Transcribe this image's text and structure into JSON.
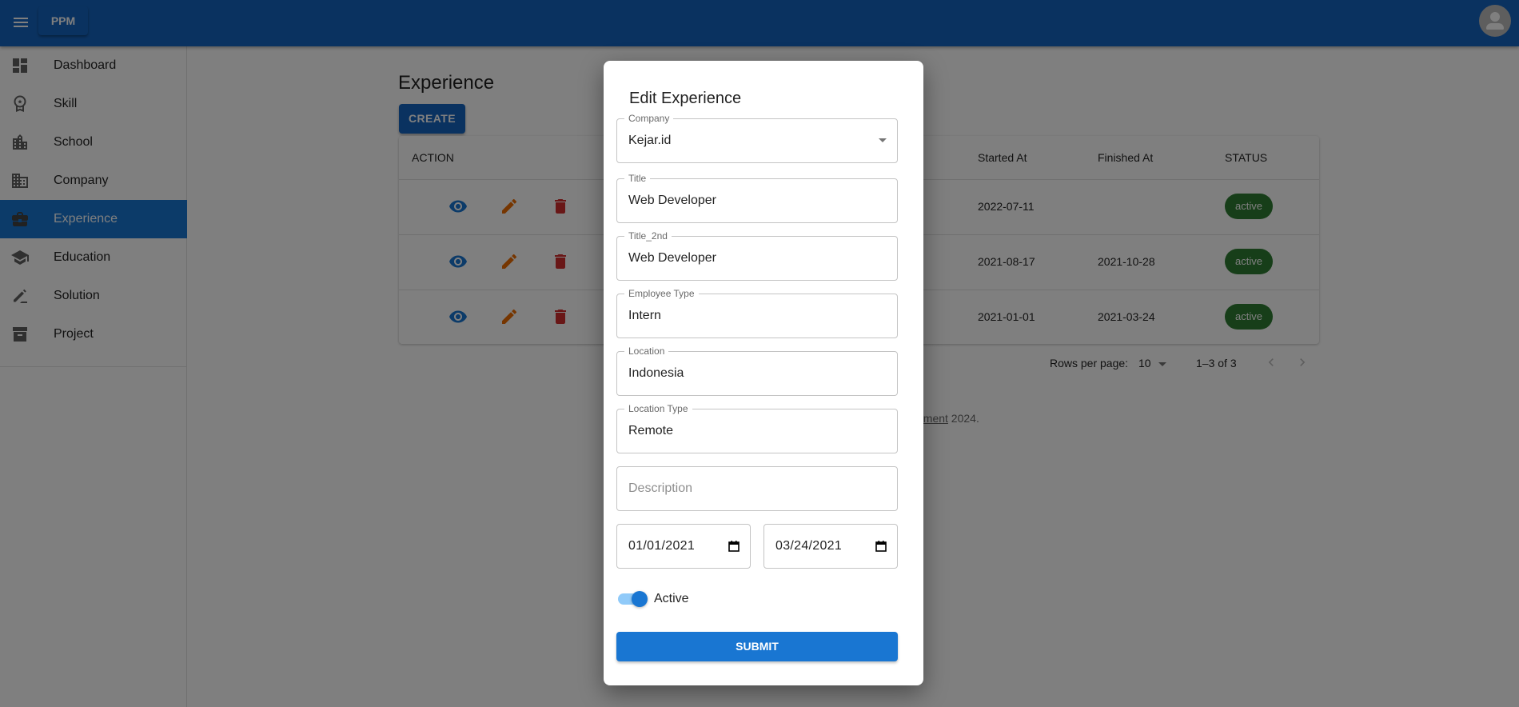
{
  "appbar": {
    "brand": "PPM",
    "menu_icon": "menu-icon",
    "avatar_icon": "person-icon"
  },
  "sidebar": {
    "items": [
      {
        "label": "Dashboard",
        "icon": "dashboard-icon",
        "active": false
      },
      {
        "label": "Skill",
        "icon": "award-icon",
        "active": false
      },
      {
        "label": "School",
        "icon": "school-building-icon",
        "active": false
      },
      {
        "label": "Company",
        "icon": "company-building-icon",
        "active": false
      },
      {
        "label": "Experience",
        "icon": "briefcase-icon",
        "active": true
      },
      {
        "label": "Education",
        "icon": "graduation-cap-icon",
        "active": false
      },
      {
        "label": "Solution",
        "icon": "pencil-line-icon",
        "active": false
      },
      {
        "label": "Project",
        "icon": "archive-box-icon",
        "active": false
      }
    ]
  },
  "main": {
    "title": "Experience",
    "create_label": "CREATE",
    "table": {
      "headers": {
        "action": "ACTION",
        "started_at": "Started At",
        "finished_at": "Finished At",
        "status": "STATUS"
      },
      "rows": [
        {
          "started_at": "2022-07-11",
          "finished_at": "",
          "status": "active"
        },
        {
          "started_at": "2021-08-17",
          "finished_at": "2021-10-28",
          "status": "active"
        },
        {
          "started_at": "2021-01-01",
          "finished_at": "2021-03-24",
          "status": "active"
        }
      ],
      "row_actions": [
        "view-icon",
        "edit-icon",
        "delete-icon"
      ]
    },
    "pagination": {
      "rows_per_page_label": "Rows per page:",
      "rows_per_page_value": "10",
      "range": "1–3 of 3"
    },
    "footer": {
      "link_fragment": "ement",
      "text_after": " 2024."
    }
  },
  "modal": {
    "title": "Edit Experience",
    "fields": {
      "company": {
        "label": "Company",
        "value": "Kejar.id"
      },
      "title": {
        "label": "Title",
        "value": "Web Developer"
      },
      "title_2nd": {
        "label": "Title_2nd",
        "value": "Web Developer"
      },
      "employee_type": {
        "label": "Employee Type",
        "value": "Intern"
      },
      "location": {
        "label": "Location",
        "value": "Indonesia"
      },
      "location_type": {
        "label": "Location Type",
        "value": "Remote"
      },
      "description": {
        "placeholder": "Description",
        "value": ""
      },
      "start_date": {
        "value": "01/01/2021"
      },
      "end_date": {
        "value": "03/24/2021"
      }
    },
    "active_toggle": {
      "label": "Active",
      "checked": true
    },
    "submit_label": "SUBMIT"
  },
  "colors": {
    "primary": "#1976d2",
    "appbar": "#1565c0",
    "view": "#1976d2",
    "edit": "#ed6c02",
    "delete": "#d32f2f",
    "status_active": "#2e7d32"
  }
}
